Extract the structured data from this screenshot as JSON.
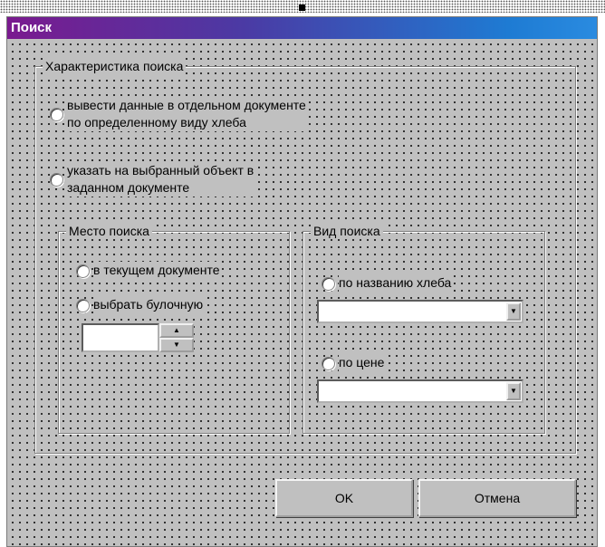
{
  "window": {
    "title": "Поиск"
  },
  "characteristic_group": {
    "label": "Характеристика поиска",
    "option_document": "вывести данные в отдельном документе\nпо определенному виду хлеба",
    "option_object": "указать на выбранный объект в\nзаданном документе"
  },
  "place_group": {
    "label": "Место поиска",
    "option_current": "в текущем документе",
    "option_bakery": "выбрать булочную",
    "spinner_value": ""
  },
  "type_group": {
    "label": "Вид поиска",
    "option_name": "по названию хлеба",
    "name_combo_value": "",
    "option_price": "по цене",
    "price_combo_value": ""
  },
  "buttons": {
    "ok": "OK",
    "cancel": "Отмена"
  },
  "icons": {
    "combo_arrow": "chevron-down-icon",
    "spin_up": "triangle-up-icon",
    "spin_down": "triangle-down-icon"
  },
  "colors": {
    "title_gradient_start": "#7a1a8f",
    "title_gradient_end": "#2a8be0",
    "face": "#c0c0c0"
  }
}
